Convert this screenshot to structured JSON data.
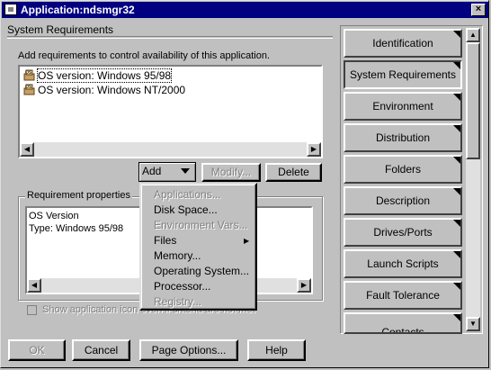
{
  "window": {
    "title": "Application:ndsmgr32",
    "close_glyph": "×"
  },
  "panel": {
    "title": "System Requirements",
    "description": "Add requirements to control availability of this application."
  },
  "requirements": [
    {
      "label": "OS version: Windows 95/98",
      "icon": "os-icon",
      "selected": true
    },
    {
      "label": "OS version: Windows NT/2000",
      "icon": "os-icon",
      "selected": false
    }
  ],
  "buttons": {
    "add": "Add",
    "modify": "Modify...",
    "delete": "Delete"
  },
  "properties": {
    "legend": "Requirement properties",
    "line1": "OS Version",
    "line2": "Type: Windows 95/98"
  },
  "checkbox": {
    "label": "Show application icon even if criteria are not met",
    "checked": false
  },
  "add_menu": [
    {
      "label": "Applications...",
      "enabled": false,
      "submenu": false
    },
    {
      "label": "Disk Space...",
      "enabled": true,
      "submenu": false
    },
    {
      "label": "Environment Vars...",
      "enabled": false,
      "submenu": false
    },
    {
      "label": "Files",
      "enabled": true,
      "submenu": true
    },
    {
      "label": "Memory...",
      "enabled": true,
      "submenu": false
    },
    {
      "label": "Operating System...",
      "enabled": true,
      "submenu": false
    },
    {
      "label": "Processor...",
      "enabled": true,
      "submenu": false
    },
    {
      "label": "Registry...",
      "enabled": false,
      "submenu": false
    }
  ],
  "tabs": [
    "Identification",
    "System Requirements",
    "Environment",
    "Distribution",
    "Folders",
    "Description",
    "Drives/Ports",
    "Launch Scripts",
    "Fault Tolerance",
    "Contacts"
  ],
  "selected_tab": "System Requirements",
  "footer": {
    "ok": "OK",
    "cancel": "Cancel",
    "page_options": "Page Options...",
    "help": "Help"
  },
  "glyphs": {
    "left": "◀",
    "right": "▶",
    "up": "▲",
    "down": "▼",
    "submenu": "▶"
  }
}
